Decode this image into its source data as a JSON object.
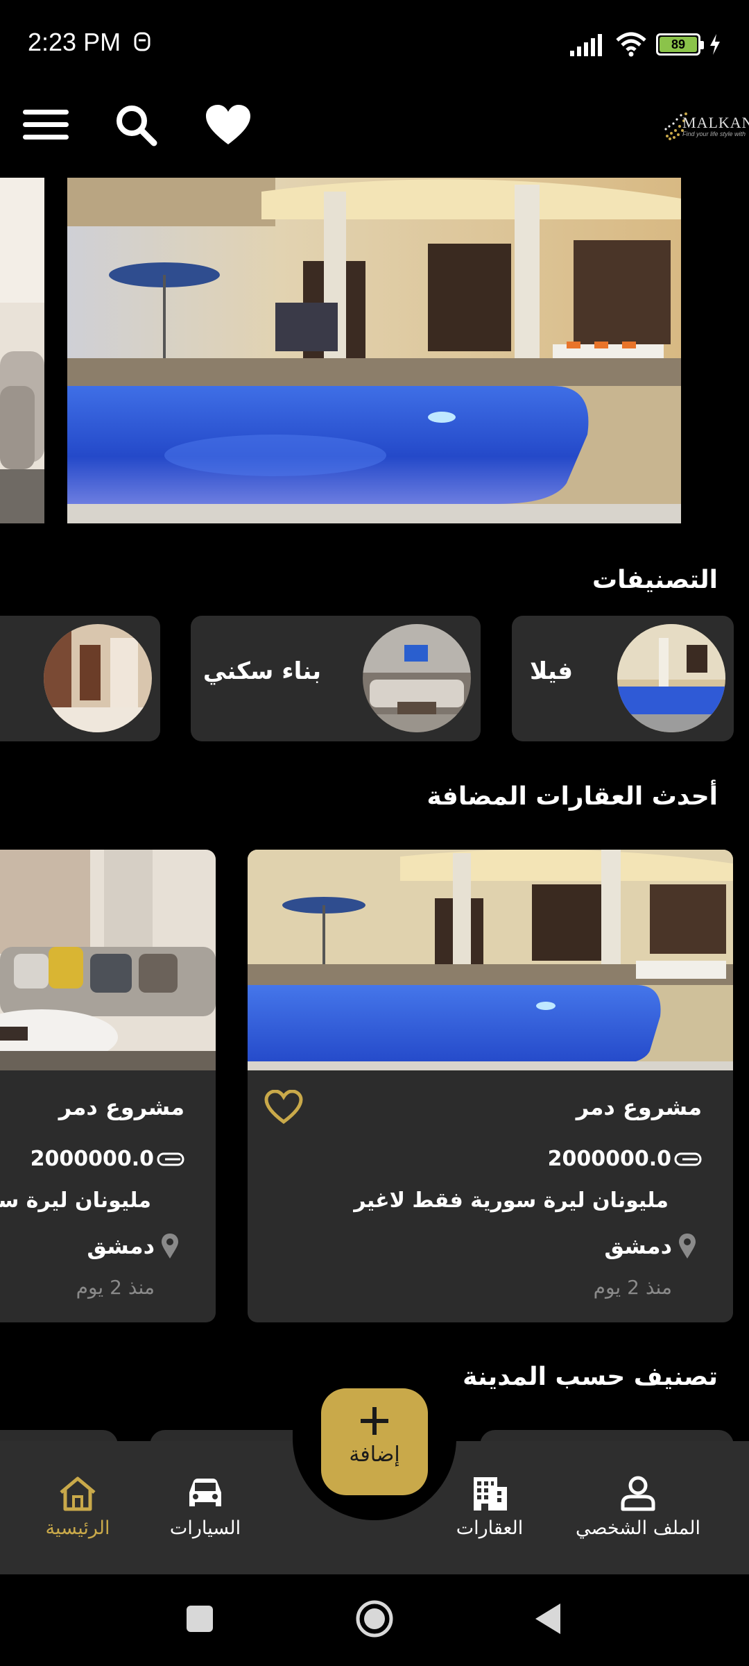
{
  "status_bar": {
    "time": "2:23 PM",
    "battery_level": "89",
    "battery_color": "#8bc34a"
  },
  "header": {
    "logo_text": "MALKANA",
    "logo_tagline": "Find your life style with"
  },
  "categories": {
    "title": "التصنيفات",
    "items": [
      {
        "label": "فيلا"
      },
      {
        "label": "بناء سكني"
      },
      {
        "label": ""
      }
    ]
  },
  "latest": {
    "title": "أحدث العقارات المضافة",
    "cards": [
      {
        "title": "مشروع دمر",
        "price": "2000000.0",
        "description": "مليونان ليرة سورية فقط لاغير",
        "city": "دمشق",
        "time_ago": "منذ 2 يوم"
      },
      {
        "title": "مشروع دمر",
        "price": "2000000.0",
        "description": "مليونان ليرة سورية فقط لاغير",
        "city": "دمشق",
        "time_ago": "منذ 2 يوم"
      }
    ]
  },
  "by_city": {
    "title": "تصنيف حسب المدينة"
  },
  "bottom_nav": {
    "items": [
      {
        "label": "الرئيسية",
        "icon": "home-icon",
        "active": true
      },
      {
        "label": "السيارات",
        "icon": "car-icon",
        "active": false
      },
      {
        "label": "العقارات",
        "icon": "building-icon",
        "active": false
      },
      {
        "label": "الملف الشخصي",
        "icon": "person-icon",
        "active": false
      }
    ],
    "fab_label": "إضافة"
  },
  "colors": {
    "accent": "#c9a94a",
    "card": "#2c2c2c",
    "background": "#000000"
  }
}
